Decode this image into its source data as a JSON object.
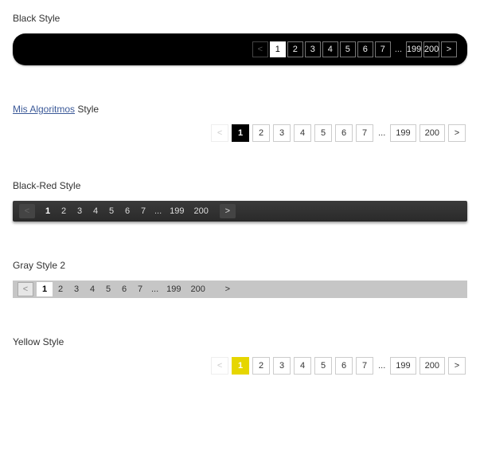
{
  "nav": {
    "prev": "<",
    "next": ">",
    "ellipsis": "..."
  },
  "pages": {
    "p1": "1",
    "p2": "2",
    "p3": "3",
    "p4": "4",
    "p5": "5",
    "p6": "6",
    "p7": "7",
    "p199": "199",
    "p200": "200"
  },
  "sections": {
    "black": {
      "title": "Black Style"
    },
    "mis": {
      "link": "Mis Algoritmos",
      "suffix": " Style"
    },
    "blackred": {
      "title": "Black-Red Style"
    },
    "gray": {
      "title": "Gray Style 2"
    },
    "yellow": {
      "title": "Yellow Style"
    }
  }
}
